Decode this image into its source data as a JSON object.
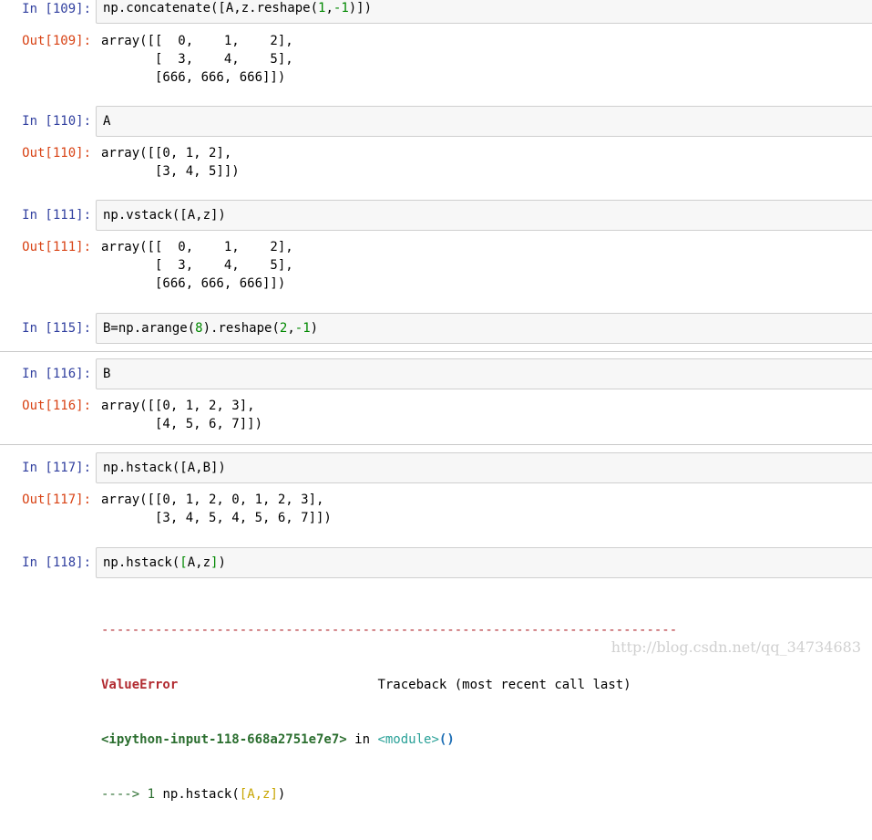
{
  "cells": [
    {
      "in_prompt": "In [109]:",
      "code_parts": [
        "np.concatenate([A,z.reshape(",
        "1",
        ",",
        "-1",
        ")])"
      ],
      "out_prompt": "Out[109]:",
      "output_lines": [
        "array([[  0,    1,    2],",
        "       [  3,    4,    5],",
        "       [666, 666, 666]])"
      ]
    },
    {
      "in_prompt": "In [110]:",
      "code_parts": [
        "A"
      ],
      "out_prompt": "Out[110]:",
      "output_lines": [
        "array([[0, 1, 2],",
        "       [3, 4, 5]])"
      ]
    },
    {
      "in_prompt": "In [111]:",
      "code_parts": [
        "np.vstack([A,z])"
      ],
      "out_prompt": "Out[111]:",
      "output_lines": [
        "array([[  0,    1,    2],",
        "       [  3,    4,    5],",
        "       [666, 666, 666]])"
      ]
    },
    {
      "in_prompt": "In [115]:",
      "code_parts": [
        "B=np.arange(",
        "8",
        ").reshape(",
        "2",
        ",",
        "-1",
        ")"
      ]
    },
    {
      "in_prompt": "In [116]:",
      "code_parts": [
        "B"
      ],
      "out_prompt": "Out[116]:",
      "output_lines": [
        "array([[0, 1, 2, 3],",
        "       [4, 5, 6, 7]])"
      ]
    },
    {
      "in_prompt": "In [117]:",
      "code_parts": [
        "np.hstack([A,B])"
      ],
      "out_prompt": "Out[117]:",
      "output_lines": [
        "array([[0, 1, 2, 0, 1, 2, 3],",
        "       [3, 4, 5, 4, 5, 6, 7]])"
      ]
    },
    {
      "in_prompt": "In [118]:",
      "code_parts": [
        "np.hstack(",
        "[",
        "A,z",
        "]",
        ")"
      ]
    }
  ],
  "error": {
    "dashes": "---------------------------------------------------------------------------",
    "name": "ValueError",
    "traceback_label": "Traceback (most recent call last)",
    "file": "<ipython-input-118-668a2751e7e7>",
    "in_word": "in",
    "module": "<module>",
    "module_paren": "()",
    "arrow": "---->",
    "line_no": "1",
    "line_code_prefix": "np.hstack(",
    "line_code_hl": "[A,z]",
    "line_code_suffix": ")"
  },
  "watermark": "http://blog.csdn.net/qq_34734683"
}
